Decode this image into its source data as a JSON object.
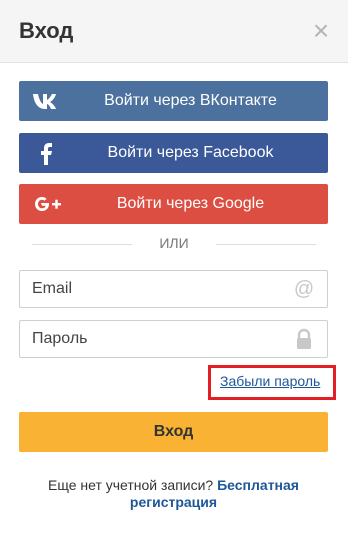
{
  "header": {
    "title": "Вход",
    "close_glyph": "×"
  },
  "social": {
    "vk": {
      "label": "Войти через ВКонтакте",
      "icon": "vk-icon",
      "color": "#4c719e"
    },
    "facebook": {
      "label": "Войти через Facebook",
      "icon": "facebook-icon",
      "color": "#3b5998"
    },
    "google": {
      "label": "Войти через Google",
      "icon": "google-plus-icon",
      "color": "#dc4e41"
    }
  },
  "divider": {
    "text": "ИЛИ"
  },
  "form": {
    "email": {
      "value": "",
      "placeholder": "Email",
      "icon": "at-icon"
    },
    "password": {
      "value": "",
      "placeholder": "Пароль",
      "icon": "lock-icon"
    },
    "forgot_label": "Забыли пароль",
    "submit_label": "Вход"
  },
  "signup": {
    "prompt": "Еще нет учетной записи?",
    "link_label": "Бесплатная регистрация"
  },
  "colors": {
    "accent": "#f9b233",
    "link": "#1e5799",
    "highlight": "#e31e24"
  }
}
